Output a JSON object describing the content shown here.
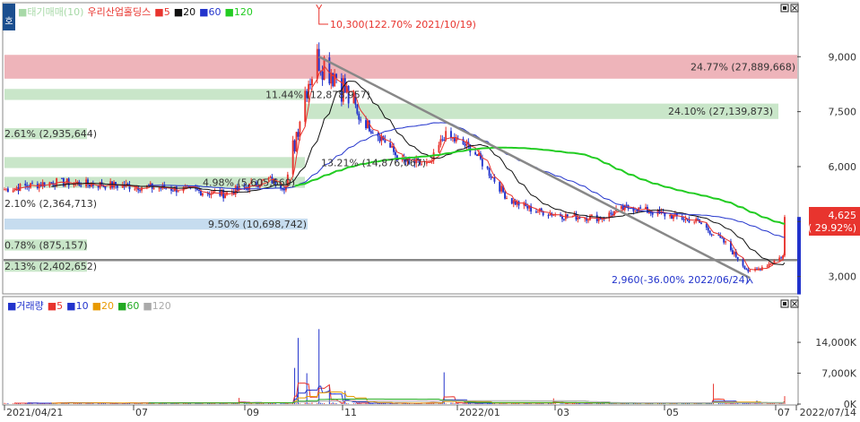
{
  "legend_main": [
    {
      "label": "■태기매매(10)",
      "color": "#a7d9a7"
    },
    {
      "label": "우리산업홀딩스",
      "color": "#e8342e"
    },
    {
      "label": "■5",
      "color": "#e8342e"
    },
    {
      "label": "■20",
      "color": "#111111"
    },
    {
      "label": "■60",
      "color": "#2233cc"
    },
    {
      "label": "■120",
      "color": "#22cc22"
    }
  ],
  "legend_volume": [
    {
      "label": "■거래량",
      "color": "#2233cc"
    },
    {
      "label": "■5",
      "color": "#e8342e"
    },
    {
      "label": "■10",
      "color": "#2233cc"
    },
    {
      "label": "■20",
      "color": "#e89a00"
    },
    {
      "label": "■60",
      "color": "#22aa22"
    },
    {
      "label": "■120",
      "color": "#aaaaaa"
    }
  ],
  "corner_tag": "호",
  "bands": [
    {
      "label": "24.77% (27,889,668)",
      "color": "#eeb4ba",
      "text_color": "#333333",
      "low": 8400,
      "high": 9050
    },
    {
      "label": "24.10% (27,139,873)",
      "color": "#c9e6c9",
      "text_color": "#333333",
      "low": 7300,
      "high": 7720
    },
    {
      "label": "11.44% (12,878,957)",
      "color": "#c9e6c9",
      "text_color": "#333333",
      "low": 7820,
      "high": 8120
    },
    {
      "label": "2.61% (2,935,644)",
      "color": "#c9e6c9",
      "text_color": "#333333",
      "low": 6750,
      "high": 7050
    },
    {
      "label": "13.21% (14,876,067)",
      "color": "#c9e6c9",
      "text_color": "#333333",
      "low": 5960,
      "high": 6260
    },
    {
      "label": "4.98% (5,605,660)",
      "color": "#c9e6c9",
      "text_color": "#333333",
      "low": 5420,
      "high": 5720
    },
    {
      "label": "2.10% (2,364,713)",
      "color": "#ffffff",
      "text_color": "#333333",
      "low": 4850,
      "high": 5150
    },
    {
      "label": "9.50% (10,698,742)",
      "color": "#c6dcef",
      "text_color": "#333333",
      "low": 4280,
      "high": 4580
    },
    {
      "label": "0.78% (875,157)",
      "color": "#c9e6c9",
      "text_color": "#333333",
      "low": 3710,
      "high": 4010
    },
    {
      "label": "2.13% (2,402,652)",
      "color": "#c9e6c9",
      "text_color": "#333333",
      "low": 3130,
      "high": 3430
    }
  ],
  "annotations": {
    "high": "10,300(122.70% 2021/10/19)",
    "low": "2,960(-36.00% 2022/06/24)",
    "last_price": "4,625",
    "last_change": "( 29.92%)"
  },
  "chart_data": [
    {
      "type": "candlestick",
      "title": "우리산업홀딩스",
      "x_ticks": [
        "2021/04/21",
        "07",
        "09",
        "11",
        "2022/01",
        "03",
        "05",
        "07",
        "2022/07/14"
      ],
      "y_ticks": [
        3000,
        4500,
        6000,
        7500,
        9000
      ],
      "y_tick_labels": [
        "3,000",
        "4,500",
        "6,000",
        "7,500",
        "9,000"
      ],
      "ylim": [
        2550,
        10450
      ],
      "support_level": 3450,
      "trend_line": [
        {
          "date": "2021/10/19",
          "price": 9000
        },
        {
          "date": "2022/06/24",
          "price": 2960
        }
      ],
      "high": {
        "date": "2021/10/19",
        "price": 10300,
        "change_pct": 122.7
      },
      "low": {
        "date": "2022/06/24",
        "price": 2960,
        "change_pct": -36.0
      },
      "last": {
        "date": "2022/07/14",
        "price": 4625,
        "change_pct": 29.92
      },
      "price_anchors": [
        {
          "date": "2021/04/21",
          "price": 5380
        },
        {
          "date": "2021/05/20",
          "price": 5580
        },
        {
          "date": "2021/06/10",
          "price": 5520
        },
        {
          "date": "2021/07/10",
          "price": 5450
        },
        {
          "date": "2021/08/01",
          "price": 5380
        },
        {
          "date": "2021/08/25",
          "price": 5250
        },
        {
          "date": "2021/09/10",
          "price": 5480
        },
        {
          "date": "2021/09/20",
          "price": 5650
        },
        {
          "date": "2021/09/30",
          "price": 5450
        },
        {
          "date": "2021/10/07",
          "price": 7200
        },
        {
          "date": "2021/10/12",
          "price": 8300
        },
        {
          "date": "2021/10/19",
          "price": 9000
        },
        {
          "date": "2021/10/30",
          "price": 8450
        },
        {
          "date": "2021/11/10",
          "price": 7400
        },
        {
          "date": "2021/11/25",
          "price": 6750
        },
        {
          "date": "2021/12/05",
          "price": 6150
        },
        {
          "date": "2021/12/22",
          "price": 6050
        },
        {
          "date": "2021/12/30",
          "price": 6850
        },
        {
          "date": "2022/01/15",
          "price": 6500
        },
        {
          "date": "2022/02/05",
          "price": 5100
        },
        {
          "date": "2022/02/20",
          "price": 4800
        },
        {
          "date": "2022/03/10",
          "price": 4650
        },
        {
          "date": "2022/03/30",
          "price": 4600
        },
        {
          "date": "2022/04/15",
          "price": 4900
        },
        {
          "date": "2022/05/10",
          "price": 4650
        },
        {
          "date": "2022/05/25",
          "price": 4500
        },
        {
          "date": "2022/06/10",
          "price": 3900
        },
        {
          "date": "2022/06/24",
          "price": 3100
        },
        {
          "date": "2022/07/05",
          "price": 3350
        },
        {
          "date": "2022/07/13",
          "price": 3560
        },
        {
          "date": "2022/07/14",
          "price": 4625
        }
      ],
      "moving_averages": [
        {
          "name": "5",
          "color": "#e8342e"
        },
        {
          "name": "20",
          "color": "#111111"
        },
        {
          "name": "60",
          "color": "#2233cc"
        },
        {
          "name": "120",
          "color": "#22cc22"
        }
      ]
    },
    {
      "type": "bar",
      "title": "거래량",
      "y_ticks": [
        0,
        7000,
        14000
      ],
      "y_tick_labels": [
        "0K",
        "7,000K",
        "14,000K"
      ],
      "ylim": [
        0,
        19500
      ],
      "volume_spikes": [
        {
          "date": "2021/09/03",
          "value": 1400
        },
        {
          "date": "2021/10/05",
          "value": 8200
        },
        {
          "date": "2021/10/07",
          "value": 15000
        },
        {
          "date": "2021/10/12",
          "value": 7000
        },
        {
          "date": "2021/10/19",
          "value": 17000
        },
        {
          "date": "2021/10/25",
          "value": 4200
        },
        {
          "date": "2021/11/03",
          "value": 3000
        },
        {
          "date": "2021/12/30",
          "value": 7200
        },
        {
          "date": "2022/03/03",
          "value": 1300
        },
        {
          "date": "2022/06/03",
          "value": 4600
        },
        {
          "date": "2022/06/28",
          "value": 800
        },
        {
          "date": "2022/07/14",
          "value": 1800
        }
      ]
    }
  ]
}
